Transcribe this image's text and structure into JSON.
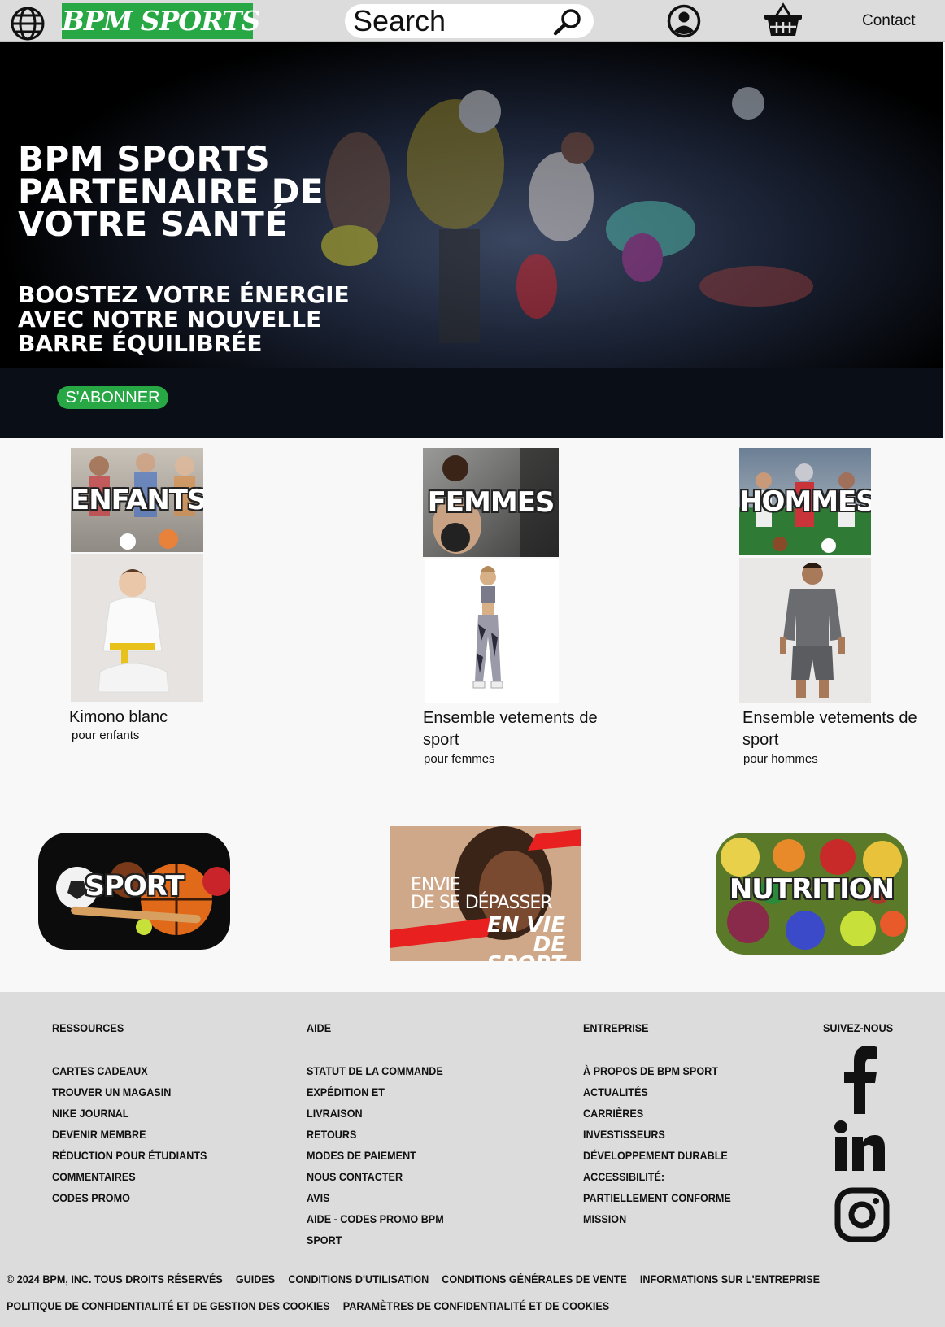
{
  "header": {
    "logo": "BPM SPORTS",
    "search_placeholder": "Search",
    "contact": "Contact"
  },
  "hero": {
    "title_lines": [
      "BPM SPORTS",
      "PARTENAIRE DE",
      "VOTRE SANTÉ"
    ],
    "subtitle_lines": [
      "BOOSTEZ VOTRE ÉNERGIE",
      "AVEC NOTRE NOUVELLE",
      "BARRE ÉQUILIBRÉE"
    ],
    "cta": "S'ABONNER"
  },
  "categories": [
    {
      "label": "ENFANTS",
      "product_title": "Kimono blanc",
      "product_subtitle": "pour enfants"
    },
    {
      "label": "FEMMES",
      "product_title": "Ensemble vetements de sport",
      "product_subtitle": "pour femmes"
    },
    {
      "label": "HOMMES",
      "product_title": "Ensemble vetements de sport",
      "product_subtitle": "pour hommes"
    }
  ],
  "tiles": {
    "sport": "SPORT",
    "envie_line1": "ENVIE",
    "envie_line2": "DE SE DÉPASSER",
    "envie_logo_top": "EN VIE",
    "envie_logo_bottom": "DE SPORT",
    "nutrition": "NUTRITION"
  },
  "footer": {
    "columns": [
      {
        "title": "RESSOURCES",
        "items": [
          "CARTES CADEAUX",
          "TROUVER UN MAGASIN",
          "NIKE JOURNAL",
          "DEVENIR MEMBRE",
          "RÉDUCTION POUR ÉTUDIANTS",
          "COMMENTAIRES",
          "CODES PROMO"
        ]
      },
      {
        "title": "AIDE",
        "items": [
          "STATUT DE LA COMMANDE",
          "EXPÉDITION ET",
          "LIVRAISON",
          "RETOURS",
          "MODES DE PAIEMENT",
          "NOUS CONTACTER",
          "AVIS",
          "AIDE - CODES PROMO BPM",
          "SPORT"
        ]
      },
      {
        "title": "ENTREPRISE",
        "items": [
          "À PROPOS DE BPM SPORT",
          "ACTUALITÉS",
          "CARRIÈRES",
          "INVESTISSEURS",
          "DÉVELOPPEMENT DURABLE",
          "ACCESSIBILITÉ:",
          "PARTIELLEMENT CONFORME",
          "MISSION"
        ]
      }
    ],
    "follow_title": "SUIVEZ-NOUS",
    "legal_line1": [
      "© 2024 BPM, INC. TOUS DROITS RÉSERVÉS",
      "GUIDES",
      "CONDITIONS D'UTILISATION",
      "CONDITIONS GÉNÉRALES DE VENTE",
      "INFORMATIONS SUR L'ENTREPRISE"
    ],
    "legal_line2": [
      "POLITIQUE DE CONFIDENTIALITÉ ET DE GESTION DES COOKIES",
      "PARAMÈTRES DE CONFIDENTIALITÉ ET DE COOKIES"
    ]
  },
  "colors": {
    "brand_green": "#27a845",
    "header_bg": "#dcdcdc",
    "footer_bg": "#dcdcdc"
  }
}
